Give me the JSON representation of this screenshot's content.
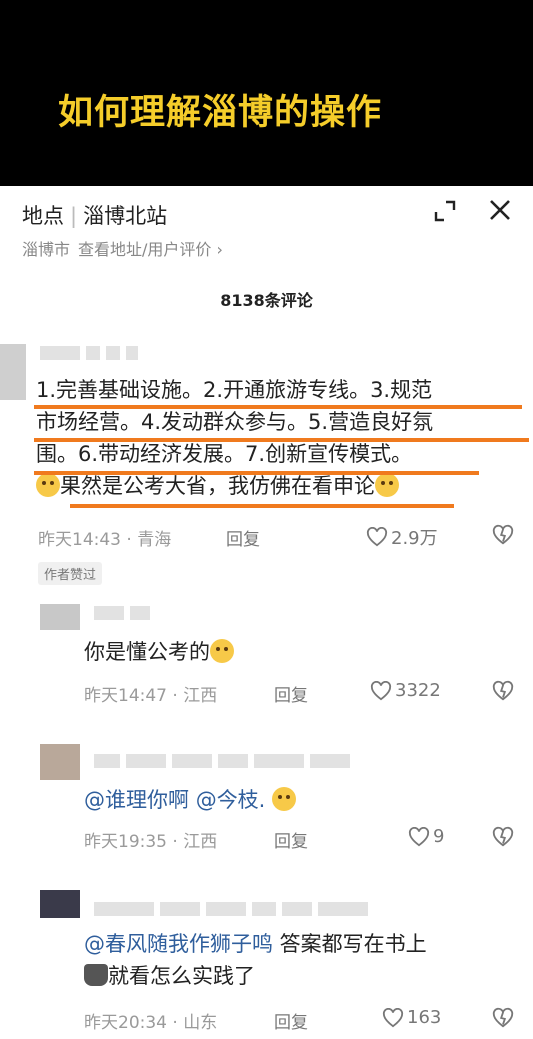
{
  "banner": {
    "title": "如何理解淄博的操作"
  },
  "location": {
    "label": "地点",
    "name": "淄博北站",
    "city": "淄博市",
    "link": "查看地址/用户评价 ›"
  },
  "comments_header": "8138条评论",
  "comments": [
    {
      "lines": [
        "1.完善基础设施。2.开通旅游专线。3.规范",
        "市场经营。4.发动群众参与。5.营造良好氛",
        "围。6.带动经济发展。7.创新宣传模式。",
        "果然是公考大省，我仿佛在看申论"
      ],
      "time": "昨天14:43 · 青海",
      "reply": "回复",
      "likes": "2.9万",
      "badge": "作者赞过"
    },
    {
      "text": "你是懂公考的",
      "time": "昨天14:47 · 江西",
      "reply": "回复",
      "likes": "3322"
    },
    {
      "mention1": "@谁理你啊",
      "mention2": "@今枝.",
      "time": "昨天19:35 · 江西",
      "reply": "回复",
      "likes": "9"
    },
    {
      "mention": "@春风随我作狮子鸣",
      "text1": " 答案都写在书上",
      "text2": "就看怎么实践了",
      "time": "昨天20:34 · 山东",
      "reply": "回复",
      "likes": "163"
    }
  ],
  "colors": {
    "banner_bg": "#000000",
    "banner_text": "#f5cd2a",
    "highlight": "#f07a1e",
    "mention": "#2f5e9c"
  }
}
